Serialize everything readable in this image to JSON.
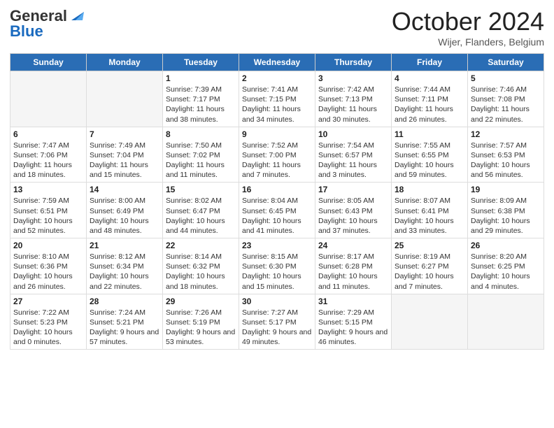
{
  "header": {
    "logo_general": "General",
    "logo_blue": "Blue",
    "month_title": "October 2024",
    "location": "Wijer, Flanders, Belgium"
  },
  "weekdays": [
    "Sunday",
    "Monday",
    "Tuesday",
    "Wednesday",
    "Thursday",
    "Friday",
    "Saturday"
  ],
  "weeks": [
    [
      {
        "day": "",
        "info": ""
      },
      {
        "day": "",
        "info": ""
      },
      {
        "day": "1",
        "info": "Sunrise: 7:39 AM\nSunset: 7:17 PM\nDaylight: 11 hours and 38 minutes."
      },
      {
        "day": "2",
        "info": "Sunrise: 7:41 AM\nSunset: 7:15 PM\nDaylight: 11 hours and 34 minutes."
      },
      {
        "day": "3",
        "info": "Sunrise: 7:42 AM\nSunset: 7:13 PM\nDaylight: 11 hours and 30 minutes."
      },
      {
        "day": "4",
        "info": "Sunrise: 7:44 AM\nSunset: 7:11 PM\nDaylight: 11 hours and 26 minutes."
      },
      {
        "day": "5",
        "info": "Sunrise: 7:46 AM\nSunset: 7:08 PM\nDaylight: 11 hours and 22 minutes."
      }
    ],
    [
      {
        "day": "6",
        "info": "Sunrise: 7:47 AM\nSunset: 7:06 PM\nDaylight: 11 hours and 18 minutes."
      },
      {
        "day": "7",
        "info": "Sunrise: 7:49 AM\nSunset: 7:04 PM\nDaylight: 11 hours and 15 minutes."
      },
      {
        "day": "8",
        "info": "Sunrise: 7:50 AM\nSunset: 7:02 PM\nDaylight: 11 hours and 11 minutes."
      },
      {
        "day": "9",
        "info": "Sunrise: 7:52 AM\nSunset: 7:00 PM\nDaylight: 11 hours and 7 minutes."
      },
      {
        "day": "10",
        "info": "Sunrise: 7:54 AM\nSunset: 6:57 PM\nDaylight: 11 hours and 3 minutes."
      },
      {
        "day": "11",
        "info": "Sunrise: 7:55 AM\nSunset: 6:55 PM\nDaylight: 10 hours and 59 minutes."
      },
      {
        "day": "12",
        "info": "Sunrise: 7:57 AM\nSunset: 6:53 PM\nDaylight: 10 hours and 56 minutes."
      }
    ],
    [
      {
        "day": "13",
        "info": "Sunrise: 7:59 AM\nSunset: 6:51 PM\nDaylight: 10 hours and 52 minutes."
      },
      {
        "day": "14",
        "info": "Sunrise: 8:00 AM\nSunset: 6:49 PM\nDaylight: 10 hours and 48 minutes."
      },
      {
        "day": "15",
        "info": "Sunrise: 8:02 AM\nSunset: 6:47 PM\nDaylight: 10 hours and 44 minutes."
      },
      {
        "day": "16",
        "info": "Sunrise: 8:04 AM\nSunset: 6:45 PM\nDaylight: 10 hours and 41 minutes."
      },
      {
        "day": "17",
        "info": "Sunrise: 8:05 AM\nSunset: 6:43 PM\nDaylight: 10 hours and 37 minutes."
      },
      {
        "day": "18",
        "info": "Sunrise: 8:07 AM\nSunset: 6:41 PM\nDaylight: 10 hours and 33 minutes."
      },
      {
        "day": "19",
        "info": "Sunrise: 8:09 AM\nSunset: 6:38 PM\nDaylight: 10 hours and 29 minutes."
      }
    ],
    [
      {
        "day": "20",
        "info": "Sunrise: 8:10 AM\nSunset: 6:36 PM\nDaylight: 10 hours and 26 minutes."
      },
      {
        "day": "21",
        "info": "Sunrise: 8:12 AM\nSunset: 6:34 PM\nDaylight: 10 hours and 22 minutes."
      },
      {
        "day": "22",
        "info": "Sunrise: 8:14 AM\nSunset: 6:32 PM\nDaylight: 10 hours and 18 minutes."
      },
      {
        "day": "23",
        "info": "Sunrise: 8:15 AM\nSunset: 6:30 PM\nDaylight: 10 hours and 15 minutes."
      },
      {
        "day": "24",
        "info": "Sunrise: 8:17 AM\nSunset: 6:28 PM\nDaylight: 10 hours and 11 minutes."
      },
      {
        "day": "25",
        "info": "Sunrise: 8:19 AM\nSunset: 6:27 PM\nDaylight: 10 hours and 7 minutes."
      },
      {
        "day": "26",
        "info": "Sunrise: 8:20 AM\nSunset: 6:25 PM\nDaylight: 10 hours and 4 minutes."
      }
    ],
    [
      {
        "day": "27",
        "info": "Sunrise: 7:22 AM\nSunset: 5:23 PM\nDaylight: 10 hours and 0 minutes."
      },
      {
        "day": "28",
        "info": "Sunrise: 7:24 AM\nSunset: 5:21 PM\nDaylight: 9 hours and 57 minutes."
      },
      {
        "day": "29",
        "info": "Sunrise: 7:26 AM\nSunset: 5:19 PM\nDaylight: 9 hours and 53 minutes."
      },
      {
        "day": "30",
        "info": "Sunrise: 7:27 AM\nSunset: 5:17 PM\nDaylight: 9 hours and 49 minutes."
      },
      {
        "day": "31",
        "info": "Sunrise: 7:29 AM\nSunset: 5:15 PM\nDaylight: 9 hours and 46 minutes."
      },
      {
        "day": "",
        "info": ""
      },
      {
        "day": "",
        "info": ""
      }
    ]
  ]
}
